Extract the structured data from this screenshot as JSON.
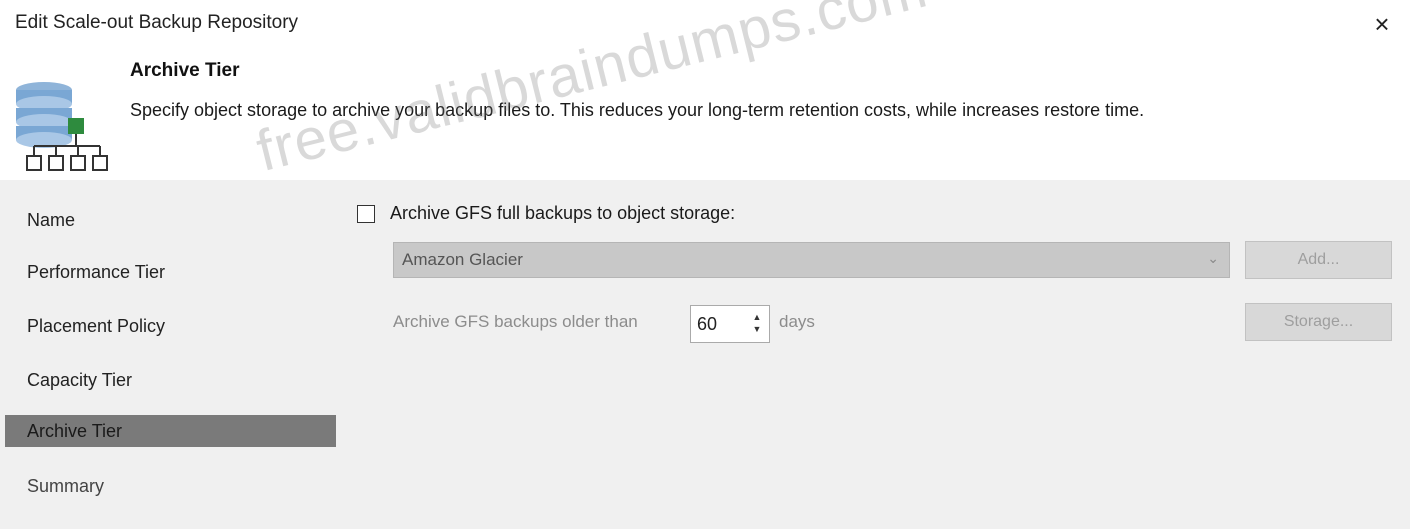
{
  "window": {
    "title": "Edit Scale-out Backup Repository",
    "close_glyph": "×"
  },
  "header": {
    "icon": "database-tier-icon",
    "step_title": "Archive Tier",
    "description": "Specify object storage to archive your backup files to. This reduces your long-term retention costs, while increases restore time."
  },
  "sidebar": {
    "items": [
      {
        "label": "Name"
      },
      {
        "label": "Performance Tier"
      },
      {
        "label": "Placement Policy"
      },
      {
        "label": "Capacity Tier"
      },
      {
        "label": "Archive Tier",
        "selected": true
      },
      {
        "label": "Summary"
      }
    ]
  },
  "form": {
    "archive_checkbox_label": "Archive GFS full backups to object storage:",
    "archive_checkbox_checked": false,
    "object_storage_value": "Amazon Glacier",
    "add_button": "Add...",
    "older_than_label": "Archive GFS backups older than",
    "older_than_value": "60",
    "days_label": "days",
    "storage_button": "Storage..."
  },
  "watermark": "free.validbraindumps.com",
  "colors": {
    "content_bg": "#f0f0f0",
    "selected_nav": "#7a7a7a",
    "disabled_text": "#8c8c8c",
    "dropdown_bg": "#c8c8c8"
  }
}
